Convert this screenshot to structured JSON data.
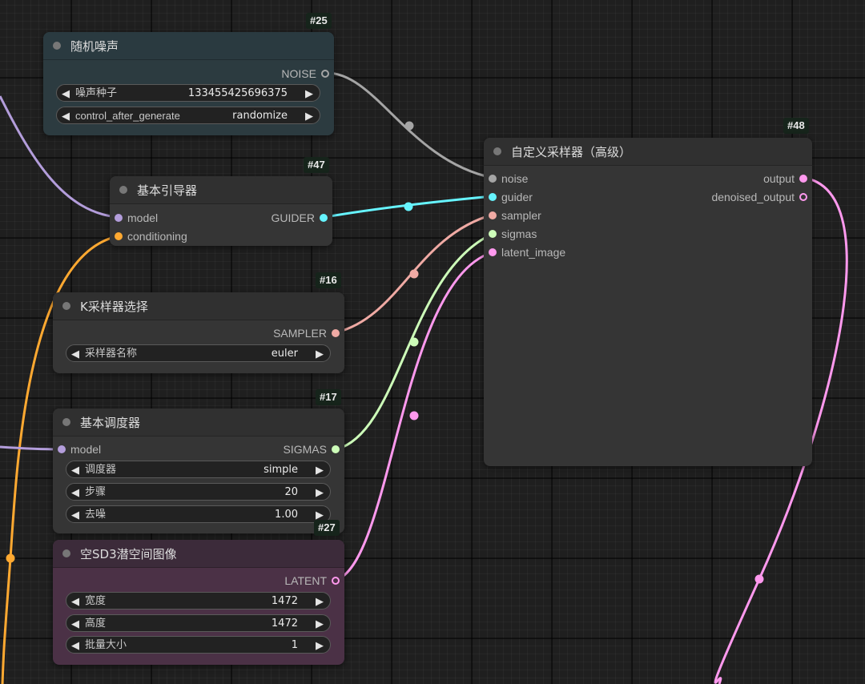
{
  "colors": {
    "noise": "#a5a5a5",
    "guider": "#66f4ff",
    "sampler": "#f0aaa4",
    "sigmas": "#cdfdb9",
    "latent": "#ff99ee",
    "model": "#b39ddb",
    "conditioning": "#ffa931",
    "latent_node_bg": "#4b3146",
    "noise_node_bg": "#2c3b40"
  },
  "nodes": {
    "random_noise": {
      "id": "#25",
      "title": "随机噪声",
      "outputs": [
        "NOISE"
      ],
      "widgets": [
        {
          "label": "噪声种子",
          "value": "133455425696375"
        },
        {
          "label": "control_after_generate",
          "value": "randomize"
        }
      ]
    },
    "basic_guider": {
      "id": "#47",
      "title": "基本引导器",
      "inputs": [
        "model",
        "conditioning"
      ],
      "outputs": [
        "GUIDER"
      ]
    },
    "ksampler_select": {
      "id": "#16",
      "title": "K采样器选择",
      "outputs": [
        "SAMPLER"
      ],
      "widgets": [
        {
          "label": "采样器名称",
          "value": "euler"
        }
      ]
    },
    "basic_scheduler": {
      "id": "#17",
      "title": "基本调度器",
      "inputs": [
        "model"
      ],
      "outputs": [
        "SIGMAS"
      ],
      "widgets": [
        {
          "label": "调度器",
          "value": "simple"
        },
        {
          "label": "步骤",
          "value": "20"
        },
        {
          "label": "去噪",
          "value": "1.00"
        }
      ]
    },
    "empty_sd3_latent": {
      "id": "#27",
      "title": "空SD3潜空间图像",
      "outputs": [
        "LATENT"
      ],
      "widgets": [
        {
          "label": "宽度",
          "value": "1472"
        },
        {
          "label": "高度",
          "value": "1472"
        },
        {
          "label": "批量大小",
          "value": "1"
        }
      ]
    },
    "custom_sampler_advanced": {
      "id": "#48",
      "title": "自定义采样器（高级）",
      "inputs": [
        "noise",
        "guider",
        "sampler",
        "sigmas",
        "latent_image"
      ],
      "outputs": [
        "output",
        "denoised_output"
      ]
    }
  },
  "glyphs": {
    "decrement": "◀",
    "increment": "▶"
  }
}
